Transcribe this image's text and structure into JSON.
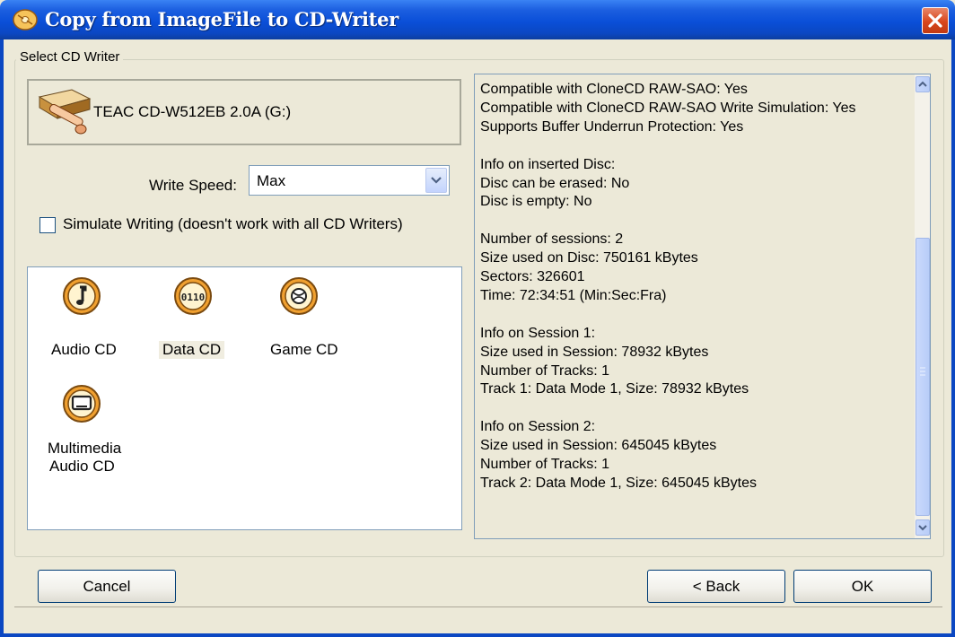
{
  "window": {
    "title": "Copy from ImageFile to CD-Writer",
    "icon": "cd-copy-icon",
    "close_icon": "close-icon"
  },
  "group": {
    "label": "Select CD Writer"
  },
  "drive": {
    "name": "TEAC CD-W512EB 2.0A (G:)",
    "icon": "cd-drive-icon"
  },
  "write_speed": {
    "label": "Write Speed:",
    "value": "Max"
  },
  "simulate": {
    "label": "Simulate Writing (doesn't work with all CD Writers)",
    "checked": false
  },
  "modes": [
    {
      "label": "Audio CD",
      "icon": "music-note-icon"
    },
    {
      "label": "Data CD",
      "icon": "binary-data-icon",
      "selected": true
    },
    {
      "label": "Game CD",
      "icon": "game-ball-icon"
    },
    {
      "label_line1": "Multimedia",
      "label_line2": "Audio CD",
      "icon": "monitor-icon"
    }
  ],
  "info": {
    "lines": [
      "Compatible with CloneCD RAW-SAO: Yes",
      "Compatible with CloneCD RAW-SAO Write Simulation: Yes",
      "Supports Buffer Underrun Protection: Yes",
      "",
      "Info on inserted Disc:",
      "Disc can be erased: No",
      "Disc is empty: No",
      "",
      "Number of sessions: 2",
      "Size used on Disc: 750161 kBytes",
      "Sectors: 326601",
      "Time: 72:34:51 (Min:Sec:Fra)",
      "",
      "Info on Session 1:",
      "Size used in Session: 78932 kBytes",
      "Number of Tracks: 1",
      "Track 1: Data Mode 1, Size: 78932 kBytes",
      "",
      "Info on Session 2:",
      "Size used in Session: 645045 kBytes",
      "Number of Tracks: 1",
      "Track 2: Data Mode 1, Size: 645045 kBytes"
    ]
  },
  "buttons": {
    "cancel": "Cancel",
    "back": "< Back",
    "ok": "OK"
  },
  "colors": {
    "title_bar": "#0b47c2",
    "dialog_bg": "#ece9d8",
    "icon_orange": "#f0a030"
  }
}
